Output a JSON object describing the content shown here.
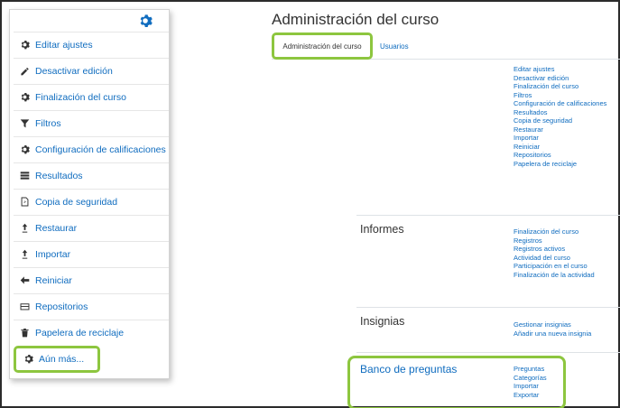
{
  "menu": {
    "items": [
      {
        "label": "Editar ajustes",
        "icon": "gear-icon"
      },
      {
        "label": "Desactivar edición",
        "icon": "pencil-icon"
      },
      {
        "label": "Finalización del curso",
        "icon": "gear-icon"
      },
      {
        "label": "Filtros",
        "icon": "filter-icon"
      },
      {
        "label": "Configuración de calificaciones",
        "icon": "gear-icon"
      },
      {
        "label": "Resultados",
        "icon": "list-icon"
      },
      {
        "label": "Copia de seguridad",
        "icon": "file-icon"
      },
      {
        "label": "Restaurar",
        "icon": "upload-icon"
      },
      {
        "label": "Importar",
        "icon": "upload-icon"
      },
      {
        "label": "Reiniciar",
        "icon": "arrow-left-icon"
      },
      {
        "label": "Repositorios",
        "icon": "box-icon"
      },
      {
        "label": "Papelera de reciclaje",
        "icon": "trash-icon"
      }
    ],
    "more_label": "Aún más..."
  },
  "page": {
    "title": "Administración del curso",
    "tabs": [
      {
        "label": "Administración del curso",
        "active": true
      },
      {
        "label": "Usuarios",
        "active": false
      }
    ]
  },
  "sections": {
    "course": {
      "title": "",
      "links": [
        "Editar ajustes",
        "Desactivar edición",
        "Finalización del curso",
        "Filtros",
        "Configuración de calificaciones",
        "Resultados",
        "Copia de seguridad",
        "Restaurar",
        "Importar",
        "Reiniciar",
        "Repositorios",
        "Papelera de reciclaje"
      ]
    },
    "reports": {
      "title": "Informes",
      "links": [
        "Finalización del curso",
        "Registros",
        "Registros activos",
        "Actividad del curso",
        "Participación en el curso",
        "Finalización de la actividad"
      ]
    },
    "badges": {
      "title": "Insignias",
      "links": [
        "Gestionar insignias",
        "Añadir una nueva insignia"
      ]
    },
    "question_bank": {
      "title": "Banco de preguntas",
      "links": [
        "Preguntas",
        "Categorías",
        "Importar",
        "Exportar"
      ]
    }
  },
  "colors": {
    "link": "#0f6cbf",
    "highlight": "#8dc63f",
    "text": "#333333"
  }
}
